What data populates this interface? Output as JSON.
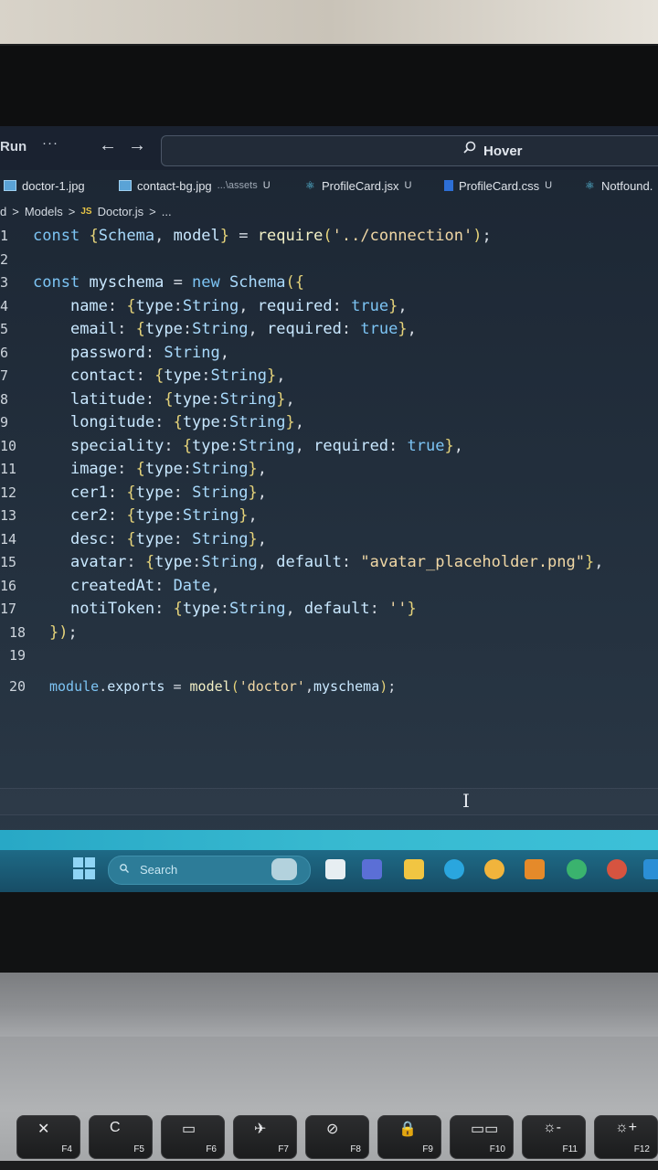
{
  "titlebar": {
    "run": "Run",
    "more": "···",
    "back": "←",
    "forward": "→",
    "search_text": "Hover"
  },
  "tabs": [
    {
      "label": "doctor-1.jpg",
      "sub": "",
      "status": "",
      "icon": "image-file-icon"
    },
    {
      "label": "contact-bg.jpg",
      "sub": "...\\assets",
      "status": "U",
      "icon": "image-file-icon"
    },
    {
      "label": "ProfileCard.jsx",
      "sub": "",
      "status": "U",
      "icon": "react-file-icon"
    },
    {
      "label": "ProfileCard.css",
      "sub": "",
      "status": "U",
      "icon": "css-file-icon"
    },
    {
      "label": "Notfound.",
      "sub": "",
      "status": "",
      "icon": "react-file-icon"
    }
  ],
  "breadcrumb": {
    "root": "d",
    "sep": ">",
    "folder": "Models",
    "js_badge": "JS",
    "file": "Doctor.js",
    "more": "..."
  },
  "editor": {
    "lines": [
      {
        "n": "1",
        "code": "const {Schema, model} = require('../connection');"
      },
      {
        "n": "2",
        "code": ""
      },
      {
        "n": "3",
        "code": "const myschema = new Schema({"
      },
      {
        "n": "4",
        "code": "    name: {type:String, required: true},"
      },
      {
        "n": "5",
        "code": "    email: {type:String, required: true},"
      },
      {
        "n": "6",
        "code": "    password: String,"
      },
      {
        "n": "7",
        "code": "    contact: {type:String},"
      },
      {
        "n": "8",
        "code": "    latitude: {type:String},"
      },
      {
        "n": "9",
        "code": "    longitude: {type:String},"
      },
      {
        "n": "10",
        "code": "    speciality: {type:String, required: true},"
      },
      {
        "n": "11",
        "code": "    image: {type:String},"
      },
      {
        "n": "12",
        "code": "    cer1: {type: String},"
      },
      {
        "n": "13",
        "code": "    cer2: {type:String},"
      },
      {
        "n": "14",
        "code": "    desc: {type: String},"
      },
      {
        "n": "15",
        "code": "    avatar: {type:String, default: \"avatar_placeholder.png\"},"
      },
      {
        "n": "16",
        "code": "    createdAt: Date,"
      },
      {
        "n": "17",
        "code": "    notiToken: {type:String, default: ''}"
      },
      {
        "n": "18",
        "code": "});"
      },
      {
        "n": "19",
        "code": ""
      },
      {
        "n": "20",
        "code": "module.exports = model('doctor',myschema);"
      }
    ]
  },
  "taskbar": {
    "search_placeholder": "Search",
    "icons": [
      "start-icon",
      "widgets-icon",
      "teams-icon",
      "file-explorer-icon",
      "edge-icon",
      "chrome-icon",
      "vlc-icon",
      "spotify-icon",
      "powerpoint-icon",
      "vscode-icon"
    ]
  },
  "keyboard": {
    "keys": [
      {
        "glyph": "✕",
        "label": "F4"
      },
      {
        "glyph": "C",
        "label": "F5"
      },
      {
        "glyph": "▭",
        "label": "F6"
      },
      {
        "glyph": "✈",
        "label": "F7"
      },
      {
        "glyph": "⊘",
        "label": "F8"
      },
      {
        "glyph": "🔒",
        "label": "F9"
      },
      {
        "glyph": "▭▭",
        "label": "F10"
      },
      {
        "glyph": "☼-",
        "label": "F11"
      },
      {
        "glyph": "☼+",
        "label": "F12"
      }
    ]
  },
  "colors": {
    "editor_bg": "#1f2a37",
    "accent": "#37b9d0",
    "keyword": "#7cc4f4",
    "string": "#f0d7a5"
  }
}
